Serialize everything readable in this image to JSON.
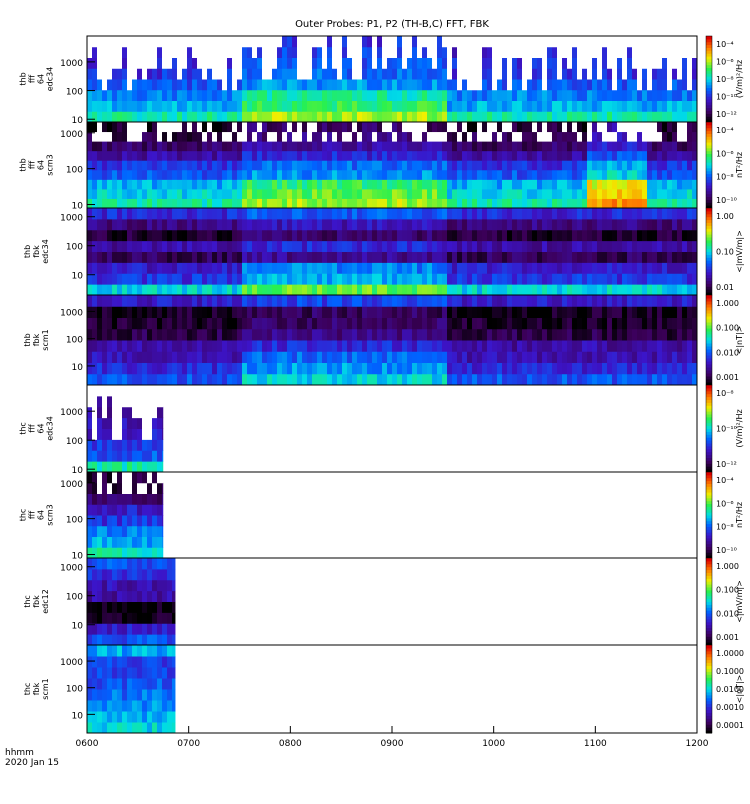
{
  "chart_data": {
    "type": "heatmap",
    "title": "Outer Probes: P1, P2 (TH-B,C) FFT, FBK",
    "xlabel": "hhmm",
    "date": "2020 Jan 15",
    "xlim_hours": [
      6,
      12
    ],
    "xticks": [
      "0600",
      "0700",
      "0800",
      "0900",
      "1000",
      "1100",
      "1200"
    ],
    "panels": [
      {
        "label": [
          "thb",
          "fff",
          "64",
          "edc34"
        ],
        "ylim": [
          8,
          8000
        ],
        "yticks": [
          "10",
          "100",
          "1000"
        ],
        "ytick_vals": [
          10,
          100,
          1000
        ],
        "cbar_ticks": [
          "10⁻⁴",
          "10⁻⁶",
          "10⁻⁸",
          "10⁻¹⁰",
          "10⁻¹²"
        ],
        "cbar_unit": "(V/m)²/Hz",
        "data_end_hours": 12,
        "style": "bursts",
        "band_levels": [
          0.55,
          0.45,
          0.4,
          0.35,
          0.3,
          0.28,
          0.25,
          0.22
        ]
      },
      {
        "label": [
          "thb",
          "fff",
          "64",
          "scm3"
        ],
        "ylim": [
          8,
          2000
        ],
        "yticks": [
          "10",
          "100",
          "1000"
        ],
        "ytick_vals": [
          10,
          100,
          1000
        ],
        "cbar_ticks": [
          "10⁻⁴",
          "10⁻⁶",
          "10⁻⁸",
          "10⁻¹⁰"
        ],
        "cbar_unit": "nT²/Hz",
        "data_end_hours": 12,
        "style": "speckle",
        "band_levels": [
          0.55,
          0.5,
          0.45,
          0.35,
          0.3,
          0.2,
          0.12,
          0.08,
          0.05
        ]
      },
      {
        "label": [
          "thb",
          "fbk",
          "edc34"
        ],
        "ylim": [
          2,
          2000
        ],
        "yticks": [
          "10",
          "100",
          "1000"
        ],
        "ytick_vals": [
          10,
          100,
          1000
        ],
        "cbar_ticks": [
          "1.00",
          "0.10",
          "0.01"
        ],
        "cbar_unit": "<|mV/m|>",
        "data_end_hours": 12,
        "style": "bands",
        "band_levels": [
          0.5,
          0.3,
          0.25,
          0.1,
          0.2,
          0.05,
          0.15,
          0.28
        ]
      },
      {
        "label": [
          "thb",
          "fbk",
          "scm1"
        ],
        "ylim": [
          2,
          4000
        ],
        "yticks": [
          "10",
          "100",
          "1000"
        ],
        "ytick_vals": [
          10,
          100,
          1000
        ],
        "cbar_ticks": [
          "1.000",
          "0.100",
          "0.010",
          "0.001"
        ],
        "cbar_unit": "<|nT|>",
        "data_end_hours": 12,
        "style": "bands",
        "band_levels": [
          0.35,
          0.28,
          0.22,
          0.2,
          0.08,
          0.04,
          0.03,
          0.25
        ]
      },
      {
        "label": [
          "thc",
          "fff",
          "64",
          "edc34"
        ],
        "ylim": [
          8,
          8000
        ],
        "yticks": [
          "10",
          "100",
          "1000"
        ],
        "ytick_vals": [
          10,
          100,
          1000
        ],
        "cbar_ticks": [
          "10⁻⁸",
          "10⁻¹⁰",
          "10⁻¹²"
        ],
        "cbar_unit": "(V/m)²/Hz",
        "data_end_hours": 6.75,
        "style": "bursts",
        "band_levels": [
          0.55,
          0.35,
          0.3,
          0.25,
          0.22,
          0.2,
          0.2,
          0.18
        ]
      },
      {
        "label": [
          "thc",
          "fff",
          "64",
          "scm3"
        ],
        "ylim": [
          8,
          2000
        ],
        "yticks": [
          "10",
          "100",
          "1000"
        ],
        "ytick_vals": [
          10,
          100,
          1000
        ],
        "cbar_ticks": [
          "10⁻⁴",
          "10⁻⁶",
          "10⁻⁸",
          "10⁻¹⁰"
        ],
        "cbar_unit": "nT²/Hz",
        "data_end_hours": 6.75,
        "style": "speckle",
        "band_levels": [
          0.55,
          0.45,
          0.4,
          0.3,
          0.25,
          0.12,
          0.08,
          0.06
        ]
      },
      {
        "label": [
          "thc",
          "fbk",
          "edc12"
        ],
        "ylim": [
          2,
          2000
        ],
        "yticks": [
          "10",
          "100",
          "1000"
        ],
        "ytick_vals": [
          10,
          100,
          1000
        ],
        "cbar_ticks": [
          "1.000",
          "0.100",
          "0.010",
          "0.001"
        ],
        "cbar_unit": "<|mV/m|>",
        "data_end_hours": 6.87,
        "style": "bands",
        "band_levels": [
          0.35,
          0.25,
          0.02,
          0.02,
          0.2,
          0.22,
          0.3,
          0.35
        ]
      },
      {
        "label": [
          "thc",
          "fbk",
          "scm1"
        ],
        "ylim": [
          2,
          4000
        ],
        "yticks": [
          "10",
          "100",
          "1000"
        ],
        "ytick_vals": [
          10,
          100,
          1000
        ],
        "cbar_ticks": [
          "1.0000",
          "0.1000",
          "0.0100",
          "0.0010",
          "0.0001"
        ],
        "cbar_unit": "<|nT|>",
        "data_end_hours": 6.87,
        "style": "bands",
        "band_levels": [
          0.5,
          0.45,
          0.42,
          0.38,
          0.35,
          0.33,
          0.32,
          0.45
        ]
      }
    ]
  }
}
